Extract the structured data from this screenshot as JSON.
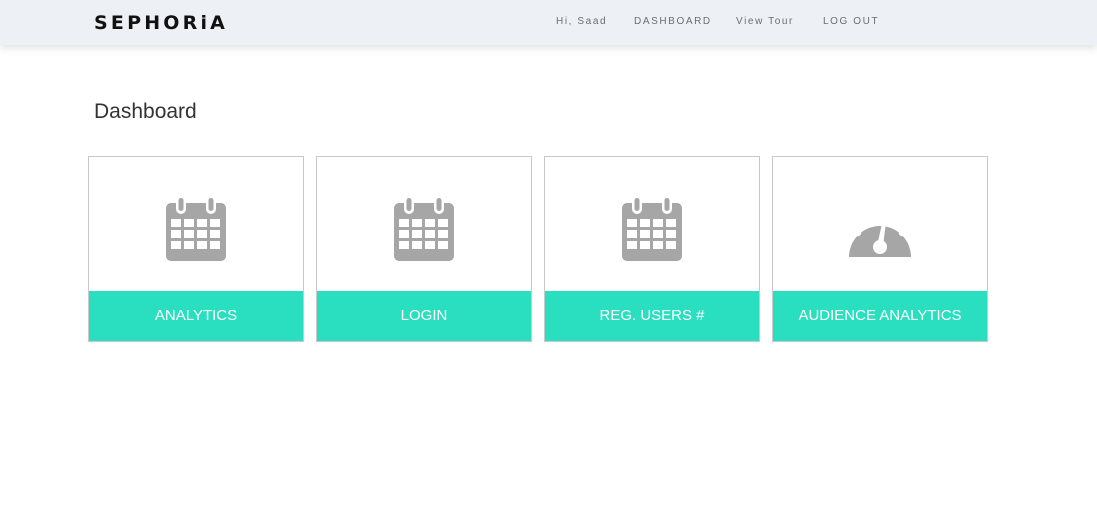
{
  "header": {
    "brand": "SEPHORiA",
    "nav": [
      {
        "label": "Hi, Saad"
      },
      {
        "label": "DASHBOARD"
      },
      {
        "label": "View Tour"
      },
      {
        "label": "LOG OUT"
      }
    ]
  },
  "main": {
    "title": "Dashboard",
    "cards": [
      {
        "label": "ANALYTICS",
        "icon": "calendar-icon"
      },
      {
        "label": "LOGIN",
        "icon": "calendar-icon"
      },
      {
        "label": "REG. USERS #",
        "icon": "calendar-icon"
      },
      {
        "label": "AUDIENCE ANALYTICS",
        "icon": "dashboard-gauge-icon"
      }
    ]
  },
  "colors": {
    "accent": "#29dfc0",
    "icon": "#a6a6a6",
    "navbar_bg": "#edf0f4"
  }
}
